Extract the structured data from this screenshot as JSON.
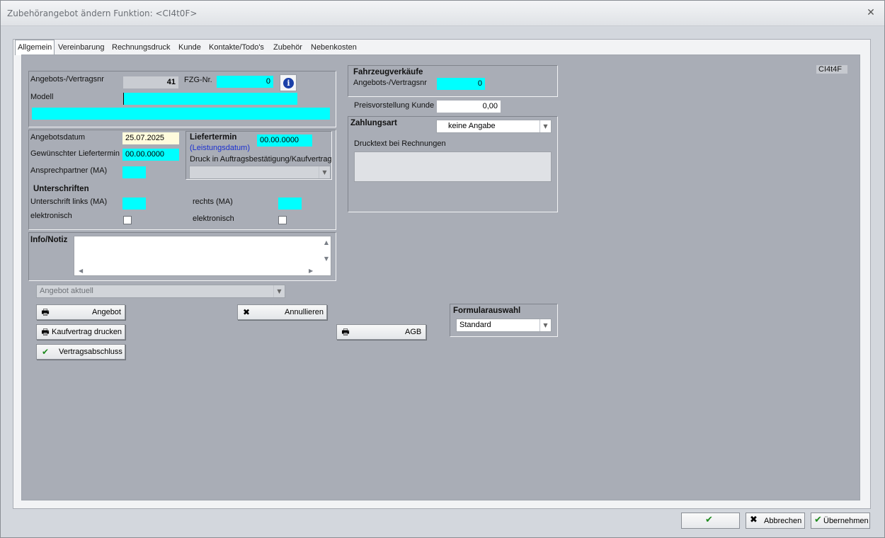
{
  "window": {
    "title": "Zubehörangebot ändern Funktion: <CI4t0F>"
  },
  "tabs": [
    "Allgemein",
    "Vereinbarung",
    "Rechnungsdruck",
    "Kunde",
    "Kontakte/Todo's",
    "Zubehör",
    "Nebenkosten"
  ],
  "header": {
    "record_code": "CI4t4F",
    "angebots_label": "Angebots-/Vertragsnr",
    "angebots_value": "41",
    "fzg_label": "FZG-Nr.",
    "fzg_value": "0",
    "modell_label": "Modell",
    "modell_value": "",
    "modell_desc": ""
  },
  "dates": {
    "angebotsdatum_label": "Angebotsdatum",
    "angebotsdatum_value": "25.07.2025",
    "wunsch_label": "Gewünschter Liefertermin",
    "wunsch_value": "00.00.0000",
    "ansprech_label": "Ansprechpartner (MA)",
    "ansprech_value": "",
    "liefertermin_label": "Liefertermin",
    "liefertermin_value": "00.00.0000",
    "leistungsdatum_label": "(Leistungsdatum)",
    "druck_label": "Druck in Auftragsbestätigung/Kaufvertrag",
    "druck_value": ""
  },
  "signatures": {
    "title": "Unterschriften",
    "links_label": "Unterschrift links (MA)",
    "links_value": "",
    "rechts_label": "rechts (MA)",
    "rechts_value": "",
    "elektronisch_label": "elektronisch",
    "elektronisch2_label": "elektronisch"
  },
  "info": {
    "label": "Info/Notiz",
    "text": ""
  },
  "status_combo": "Angebot aktuell",
  "buttons": {
    "angebot": "Angebot",
    "kaufvertrag": "Kaufvertrag drucken",
    "vertragsabschluss": "Vertragsabschluss",
    "annullieren": "Annullieren",
    "agb": "AGB"
  },
  "sales": {
    "title": "Fahrzeugverkäufe",
    "angebots_label": "Angebots-/Vertragsnr",
    "angebots_value": "0",
    "preis_label": "Preisvorstellung Kunde",
    "preis_value": "0,00",
    "zahlungsart_label": "Zahlungsart",
    "zahlungsart_value": "keine Angabe",
    "drucktext_label": "Drucktext bei Rechnungen",
    "drucktext_value": ""
  },
  "formular": {
    "label": "Formularauswahl",
    "value": "Standard"
  },
  "footer": {
    "ok": "OK",
    "abbrechen": "Abbrechen",
    "uebernehmen": "Übernehmen"
  },
  "colors": {
    "required_field": "#00ffff",
    "panel_bg": "#a9adb6"
  }
}
